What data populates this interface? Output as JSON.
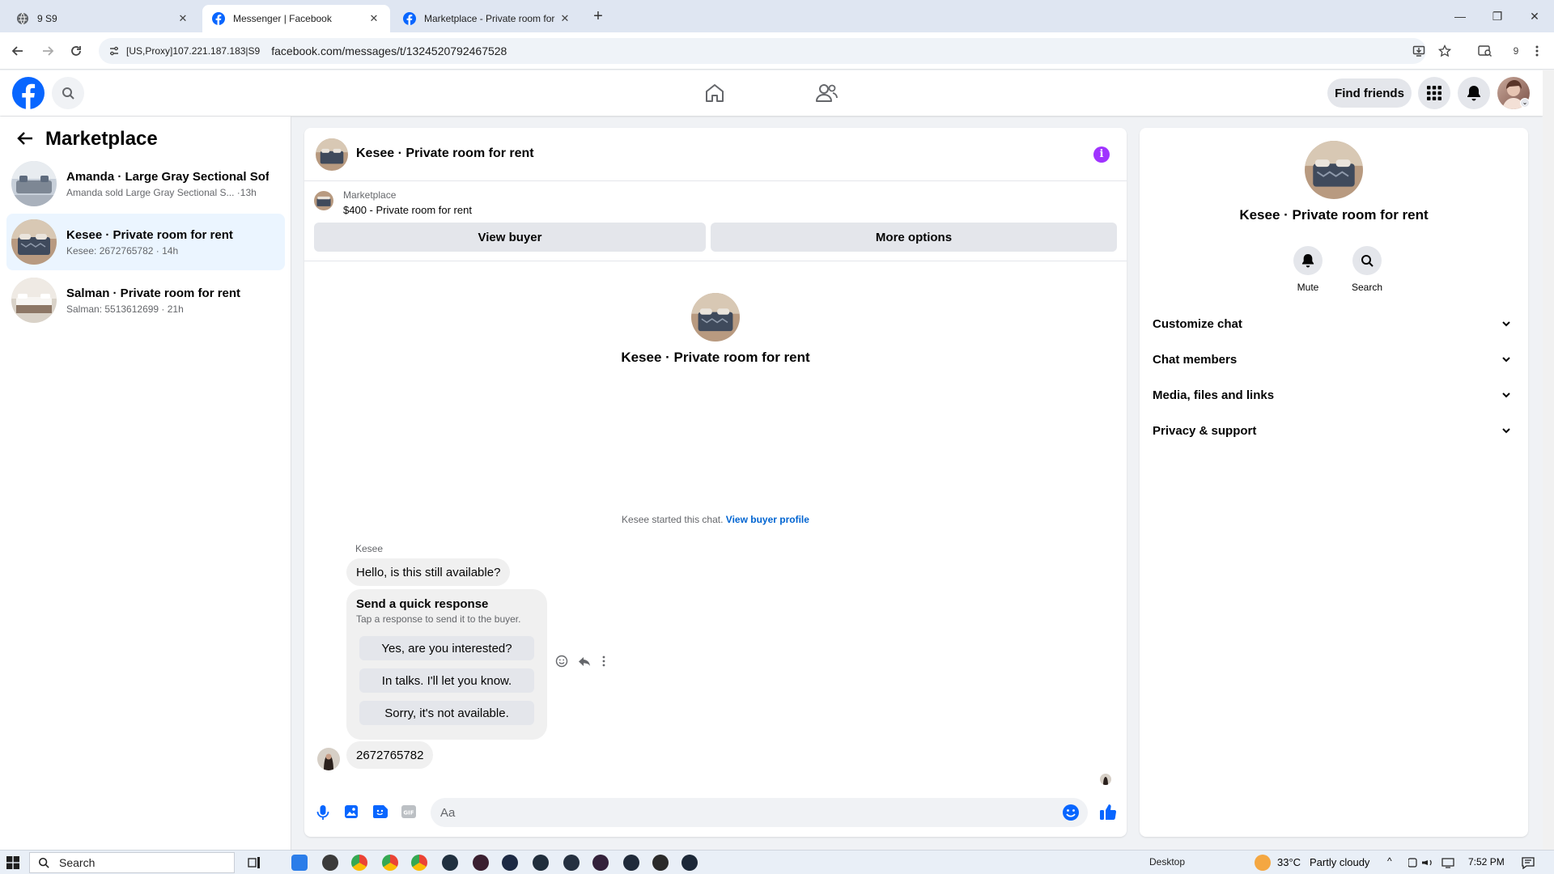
{
  "browser": {
    "tabs": [
      {
        "title": "9 S9",
        "active": false
      },
      {
        "title": "Messenger | Facebook",
        "active": true
      },
      {
        "title": "Marketplace - Private room for",
        "active": false
      }
    ],
    "proxy_label": "[US,Proxy]107.221.187.183|S9",
    "url": "facebook.com/messages/t/1324520792467528",
    "profile_count": "9"
  },
  "header": {
    "find_friends": "Find friends"
  },
  "sidebar": {
    "title": "Marketplace",
    "conversations": [
      {
        "title": "Amanda · Large Gray Sectional Sof...",
        "subtitle": "Amanda sold Large Gray Sectional S... ·13h",
        "active": false
      },
      {
        "title": "Kesee · Private room for rent",
        "subtitle": "Kesee: 2672765782 · 14h",
        "active": true
      },
      {
        "title": "Salman · Private room for rent",
        "subtitle": "Salman: 5513612699 · 21h",
        "active": false
      }
    ]
  },
  "chat": {
    "title": "Kesee · Private room for rent",
    "listing_source": "Marketplace",
    "listing_price_title": "$400 - Private room for rent",
    "view_buyer": "View buyer",
    "more_options": "More options",
    "intro_title": "Kesee · Private room for rent",
    "started_text": "Kesee started this chat.",
    "view_buyer_profile": "View buyer profile",
    "sender_name": "Kesee",
    "message_1": "Hello, is this still available?",
    "quick_title": "Send a quick response",
    "quick_subtitle": "Tap a response to send it to the buyer.",
    "quick_responses": [
      "Yes, are you interested?",
      "In talks. I'll let you know.",
      "Sorry, it's not available."
    ],
    "message_2": "2672765782",
    "composer_placeholder": "Aa"
  },
  "details": {
    "title": "Kesee · Private room for rent",
    "mute": "Mute",
    "search": "Search",
    "sections": [
      "Customize chat",
      "Chat members",
      "Media, files and links",
      "Privacy & support"
    ]
  },
  "taskbar": {
    "search": "Search",
    "desktop": "Desktop",
    "temperature": "33°C",
    "weather": "Partly cloudy",
    "time": "7:52 PM"
  },
  "colors": {
    "facebook_blue": "#0866ff",
    "selected_row": "#ebf5ff",
    "info_purple": "#a033ff",
    "link_blue": "#0064d1"
  }
}
